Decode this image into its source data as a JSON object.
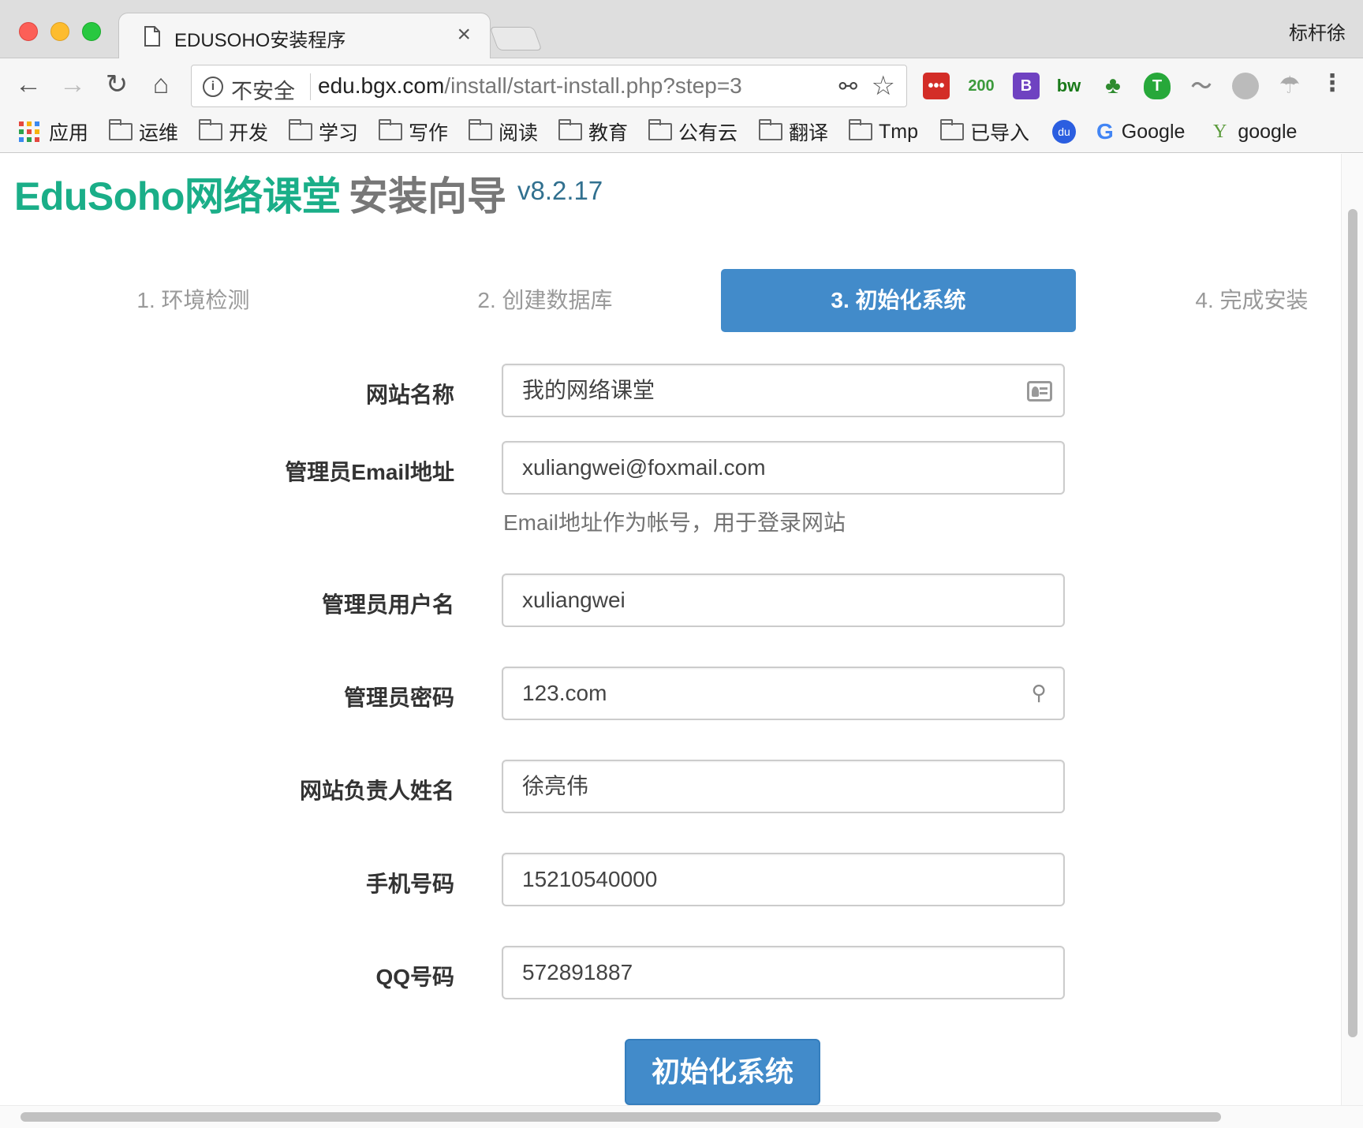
{
  "browser": {
    "tab_title": "EDUSOHO安装程序",
    "tab_close": "×",
    "profile_name": "标杆徐",
    "security_label": "不安全",
    "url_host": "edu.bgx.com",
    "url_path": "/install/start-install.php?step=3",
    "extensions": [
      {
        "name": "lastpass",
        "text": "•••",
        "color": "#d32d27"
      },
      {
        "name": "counter",
        "text": "200",
        "color": "#3c9a3c"
      },
      {
        "name": "bootstrap",
        "text": "B",
        "color": "#6f42c1"
      },
      {
        "name": "bw",
        "text": "bw",
        "color": "#1a7a1a"
      }
    ],
    "bookmarks": {
      "apps": "应用",
      "folders": [
        "运维",
        "开发",
        "学习",
        "写作",
        "阅读",
        "教育",
        "公有云",
        "翻译",
        "Tmp",
        "已导入"
      ],
      "baidu": "du",
      "google1": "Google",
      "google2": "google"
    }
  },
  "page": {
    "brand": "EduSoho网络课堂",
    "subtitle": "安装向导",
    "version": "v8.2.17",
    "steps": [
      "1. 环境检测",
      "2. 创建数据库",
      "3. 初始化系统",
      "4. 完成安装"
    ],
    "active_step": 3,
    "form": {
      "site_name": {
        "label": "网站名称",
        "value": "我的网络课堂"
      },
      "email": {
        "label": "管理员Email地址",
        "value": "xuliangwei@foxmail.com",
        "help": "Email地址作为帐号，用于登录网站"
      },
      "username": {
        "label": "管理员用户名",
        "value": "xuliangwei"
      },
      "password": {
        "label": "管理员密码",
        "value": "123.com"
      },
      "owner_name": {
        "label": "网站负责人姓名",
        "value": "徐亮伟"
      },
      "mobile": {
        "label": "手机号码",
        "value": "15210540000"
      },
      "qq": {
        "label": "QQ号码",
        "value": "572891887"
      }
    },
    "submit_label": "初始化系统"
  }
}
